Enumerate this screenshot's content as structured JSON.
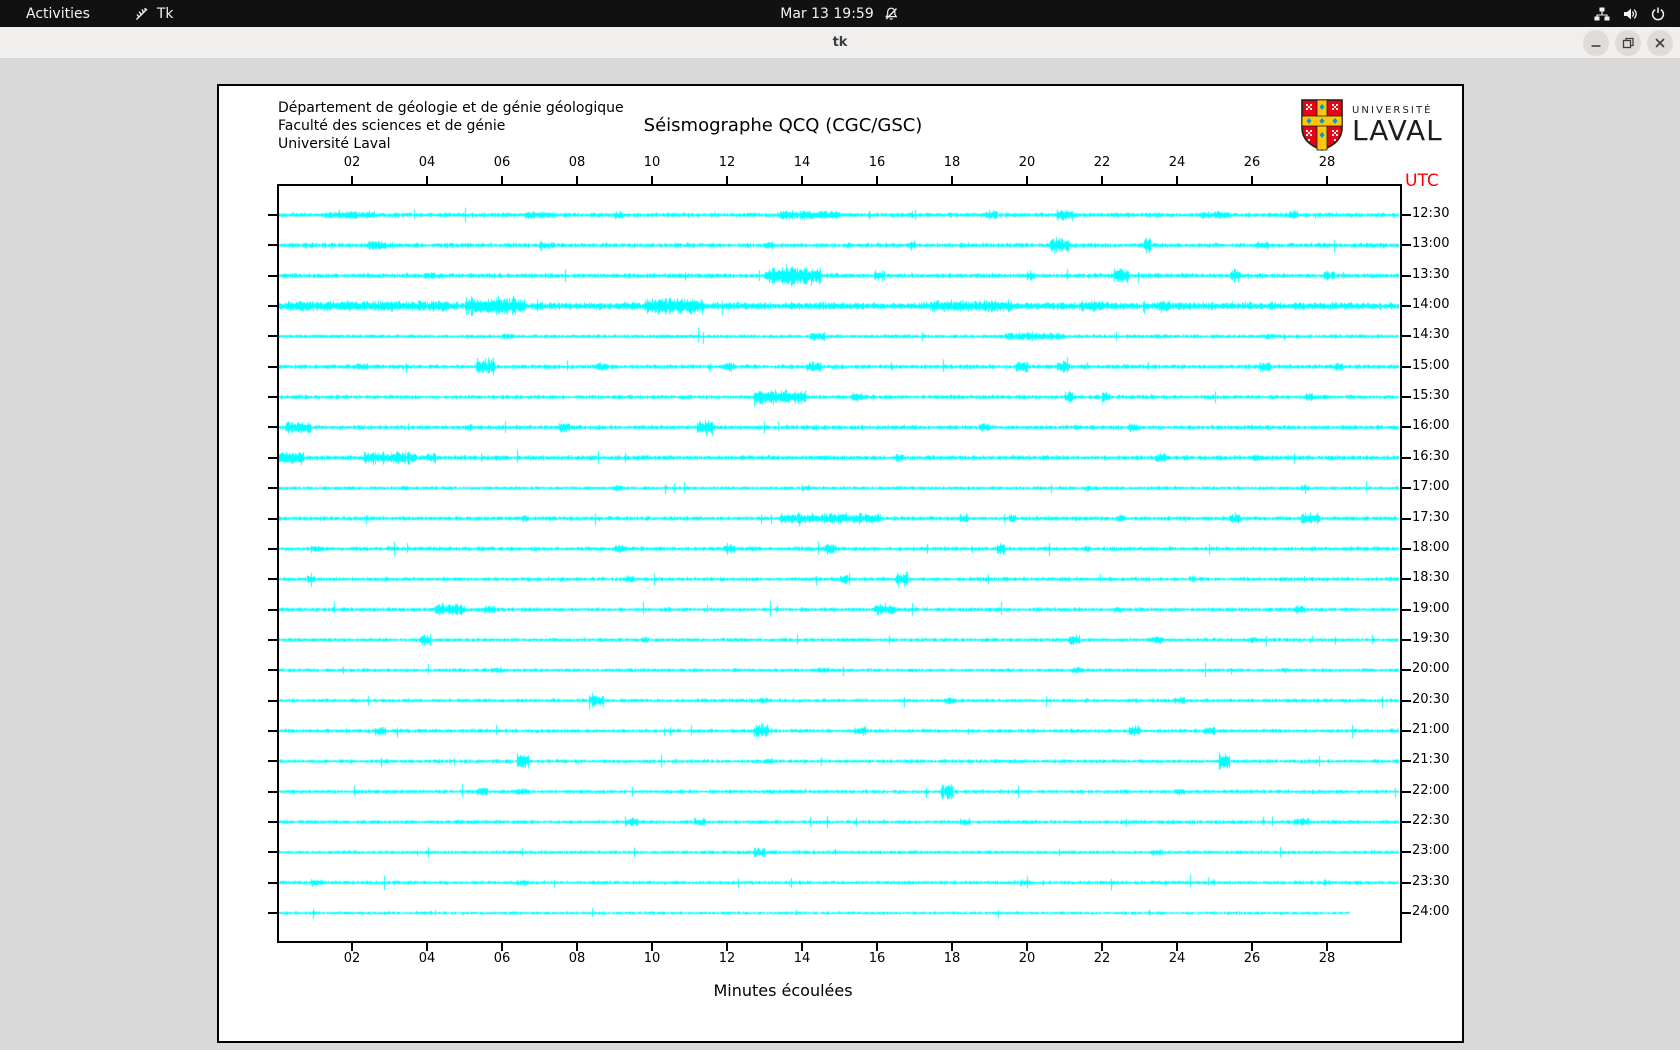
{
  "topbar": {
    "activities": "Activities",
    "app_name": "Tk",
    "clock": "Mar 13 19:59",
    "tray_icons": [
      "network-icon",
      "volume-icon",
      "power-icon"
    ],
    "clock_icon": "notifications-disabled-icon",
    "app_icon": "tk-feather-icon"
  },
  "window": {
    "title": "tk",
    "controls": [
      "minimize",
      "maximize",
      "close"
    ]
  },
  "canvas": {
    "header_lines": [
      "Département de géologie et de génie géologique",
      "Faculté des sciences et de génie",
      "Université Laval"
    ],
    "title": "Séismographe QCQ (CGC/GSC)",
    "utc_label": "UTC",
    "xaxis_label": "Minutes écoulées",
    "logo": {
      "line1": "UNIVERSITÉ",
      "line2": "LAVAL"
    },
    "logo_colors": {
      "shield_red": "#e30513",
      "cross_gold": "#ffc60b",
      "mark_blue": "#0099d8"
    }
  },
  "chart_data": {
    "type": "line",
    "subtype": "seismogram-helicorder",
    "title": "Séismographe QCQ (CGC/GSC)",
    "xlabel": "Minutes écoulées",
    "x_range": [
      0,
      30
    ],
    "x_tick_interval": 2,
    "x_ticks": [
      "02",
      "04",
      "06",
      "08",
      "10",
      "12",
      "14",
      "16",
      "18",
      "20",
      "22",
      "24",
      "26",
      "28"
    ],
    "y_axis_side": "right",
    "y_unit_label": "UTC",
    "trace_color": "#00ffff",
    "axis_color": "#000000",
    "seed": 42,
    "rows": [
      {
        "time": "12:30",
        "base": 2.0,
        "end_min": 30,
        "events": [
          [
            1.4,
            2.6,
            2
          ],
          [
            6.6,
            7.4,
            2
          ],
          [
            9,
            9.2,
            3
          ],
          [
            13.4,
            15,
            3
          ],
          [
            18.9,
            19.2,
            4
          ],
          [
            20.8,
            21.2,
            5
          ],
          [
            24.6,
            25.4,
            2
          ],
          [
            27,
            27.2,
            3
          ]
        ]
      },
      {
        "time": "13:00",
        "base": 2.0,
        "end_min": 30,
        "events": [
          [
            2.4,
            2.9,
            3
          ],
          [
            7,
            7.4,
            2
          ],
          [
            13,
            13.2,
            4
          ],
          [
            16.8,
            17,
            3
          ],
          [
            20.6,
            21.1,
            7
          ],
          [
            23.1,
            23.3,
            9
          ],
          [
            26.1,
            26.4,
            2
          ]
        ]
      },
      {
        "time": "13:30",
        "base": 2.0,
        "end_min": 30,
        "events": [
          [
            3.9,
            4.2,
            3
          ],
          [
            13,
            14.5,
            9
          ],
          [
            15.9,
            16.2,
            4
          ],
          [
            20,
            20.2,
            4
          ],
          [
            22.3,
            22.7,
            6
          ],
          [
            25.4,
            25.7,
            5
          ],
          [
            27.9,
            28.2,
            3
          ]
        ]
      },
      {
        "time": "14:00",
        "base": 3.2,
        "end_min": 30,
        "events": [
          [
            0.2,
            4.8,
            2
          ],
          [
            5.0,
            6.6,
            7
          ],
          [
            9.8,
            11.4,
            6
          ],
          [
            17.4,
            19.6,
            3
          ],
          [
            21.4,
            22,
            3
          ],
          [
            23.5,
            23.8,
            3
          ]
        ]
      },
      {
        "time": "14:30",
        "base": 1.6,
        "end_min": 30,
        "events": [
          [
            6,
            6.3,
            2
          ],
          [
            14.2,
            14.6,
            3
          ],
          [
            19.4,
            21,
            3
          ],
          [
            26.3,
            26.6,
            2
          ]
        ]
      },
      {
        "time": "15:00",
        "base": 1.9,
        "end_min": 30,
        "events": [
          [
            2.1,
            2.4,
            2
          ],
          [
            5.3,
            5.8,
            7
          ],
          [
            8.5,
            8.8,
            3
          ],
          [
            11.9,
            12.2,
            3
          ],
          [
            14.1,
            14.5,
            4
          ],
          [
            19.7,
            20,
            5
          ],
          [
            20.8,
            21.1,
            5
          ],
          [
            26.2,
            26.5,
            4
          ],
          [
            28.2,
            28.4,
            3
          ]
        ]
      },
      {
        "time": "15:30",
        "base": 1.8,
        "end_min": 30,
        "events": [
          [
            12.7,
            14.1,
            7
          ],
          [
            15.3,
            15.6,
            4
          ],
          [
            21,
            21.2,
            5
          ],
          [
            22,
            22.2,
            4
          ],
          [
            27.4,
            27.6,
            3
          ]
        ]
      },
      {
        "time": "16:00",
        "base": 1.9,
        "end_min": 30,
        "events": [
          [
            0.2,
            0.9,
            5
          ],
          [
            5,
            5.2,
            2
          ],
          [
            7.5,
            7.8,
            4
          ],
          [
            11.2,
            11.6,
            7
          ],
          [
            18.7,
            19,
            3
          ],
          [
            22.7,
            23,
            3
          ]
        ]
      },
      {
        "time": "16:30",
        "base": 2.0,
        "end_min": 30,
        "events": [
          [
            0,
            0.7,
            6
          ],
          [
            2.3,
            3.7,
            5
          ],
          [
            4,
            4.2,
            3
          ],
          [
            16.5,
            16.7,
            2
          ],
          [
            23.4,
            23.7,
            3
          ],
          [
            26,
            26.2,
            2
          ]
        ]
      },
      {
        "time": "17:00",
        "base": 1.5,
        "end_min": 30,
        "events": [
          [
            3.3,
            3.5,
            1.5
          ],
          [
            9,
            9.2,
            2
          ],
          [
            14,
            14.2,
            2
          ],
          [
            21.5,
            21.7,
            2
          ],
          [
            27.3,
            27.5,
            2
          ]
        ]
      },
      {
        "time": "17:30",
        "base": 1.8,
        "end_min": 30,
        "events": [
          [
            6.5,
            6.7,
            2
          ],
          [
            13.4,
            16.1,
            4
          ],
          [
            18.2,
            18.4,
            5
          ],
          [
            19.5,
            19.7,
            3
          ],
          [
            22.4,
            22.6,
            3
          ],
          [
            25.4,
            25.7,
            4
          ],
          [
            27.3,
            27.8,
            4
          ]
        ]
      },
      {
        "time": "18:00",
        "base": 1.8,
        "end_min": 30,
        "events": [
          [
            0.9,
            1.2,
            2
          ],
          [
            9,
            9.3,
            3
          ],
          [
            11.9,
            12.2,
            4
          ],
          [
            14.6,
            14.9,
            4
          ],
          [
            19.2,
            19.4,
            5
          ],
          [
            21.5,
            21.7,
            2
          ]
        ]
      },
      {
        "time": "18:30",
        "base": 1.7,
        "end_min": 30,
        "events": [
          [
            0.8,
            1,
            2
          ],
          [
            9.3,
            9.5,
            2
          ],
          [
            15,
            15.2,
            4
          ],
          [
            16.5,
            16.8,
            7
          ],
          [
            24.3,
            24.5,
            2
          ]
        ]
      },
      {
        "time": "19:00",
        "base": 1.7,
        "end_min": 30,
        "events": [
          [
            4.2,
            5,
            5
          ],
          [
            5.5,
            5.8,
            3
          ],
          [
            15.9,
            16.5,
            5
          ],
          [
            22.3,
            22.5,
            2
          ],
          [
            27.1,
            27.4,
            3
          ]
        ]
      },
      {
        "time": "19:30",
        "base": 1.6,
        "end_min": 30,
        "events": [
          [
            3.8,
            4.1,
            5
          ],
          [
            9.7,
            9.9,
            2
          ],
          [
            21.1,
            21.4,
            4
          ],
          [
            23.3,
            23.6,
            3
          ],
          [
            25.9,
            26.1,
            2
          ]
        ]
      },
      {
        "time": "20:00",
        "base": 1.5,
        "end_min": 30,
        "events": [
          [
            5.7,
            6,
            1.5
          ],
          [
            14.4,
            14.7,
            2
          ],
          [
            21.2,
            21.5,
            2.5
          ],
          [
            26.8,
            27,
            2
          ]
        ]
      },
      {
        "time": "20:30",
        "base": 1.6,
        "end_min": 30,
        "events": [
          [
            8.3,
            8.7,
            6
          ],
          [
            12.8,
            13.1,
            2
          ],
          [
            17.8,
            18.1,
            2.5
          ],
          [
            23.9,
            24.2,
            2
          ]
        ]
      },
      {
        "time": "21:00",
        "base": 1.7,
        "end_min": 30,
        "events": [
          [
            2.6,
            2.9,
            3
          ],
          [
            12.7,
            13.1,
            7
          ],
          [
            15.4,
            15.7,
            3
          ],
          [
            22.7,
            23,
            4
          ],
          [
            24.7,
            25,
            3
          ]
        ]
      },
      {
        "time": "21:30",
        "base": 1.6,
        "end_min": 30,
        "events": [
          [
            6.4,
            6.7,
            8
          ],
          [
            13,
            13.2,
            2
          ],
          [
            25.1,
            25.4,
            8
          ]
        ]
      },
      {
        "time": "22:00",
        "base": 1.6,
        "end_min": 30,
        "events": [
          [
            5.3,
            5.6,
            3
          ],
          [
            6.4,
            6.7,
            2
          ],
          [
            17.7,
            18,
            8
          ],
          [
            24,
            24.2,
            2
          ]
        ]
      },
      {
        "time": "22:30",
        "base": 1.6,
        "end_min": 30,
        "events": [
          [
            9.3,
            9.6,
            4
          ],
          [
            11.1,
            11.4,
            3
          ],
          [
            18.2,
            18.5,
            2
          ],
          [
            27.1,
            27.5,
            3
          ]
        ]
      },
      {
        "time": "23:00",
        "base": 1.5,
        "end_min": 30,
        "events": [
          [
            12.7,
            13,
            4
          ],
          [
            23.3,
            23.6,
            2
          ]
        ]
      },
      {
        "time": "23:30",
        "base": 1.6,
        "end_min": 30,
        "events": [
          [
            0.9,
            1.2,
            3
          ],
          [
            6.4,
            6.7,
            2
          ],
          [
            19.8,
            20.1,
            2
          ],
          [
            27.9,
            28.1,
            2
          ]
        ]
      },
      {
        "time": "24:00",
        "base": 1.3,
        "end_min": 28.6,
        "events": []
      }
    ]
  }
}
